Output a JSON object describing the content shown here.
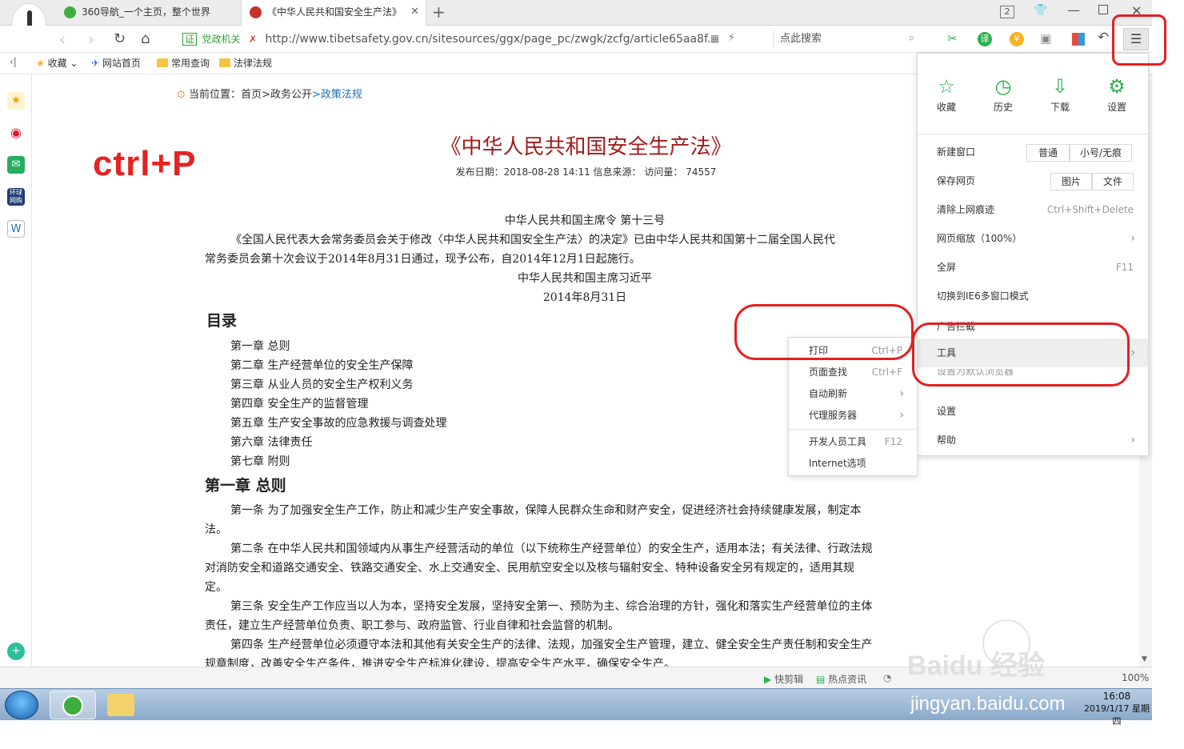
{
  "tabs": [
    {
      "title": "360导航_一个主页，整个世界"
    },
    {
      "title": "《中华人民共和国安全生产法》"
    }
  ],
  "tabbar": {
    "tab_count": "2"
  },
  "address": {
    "badge": "证",
    "site_label": "党政机关",
    "url": "http://www.tibetsafety.gov.cn/sitesources/ggx/page_pc/zwgk/zcfg/article65aa8f.",
    "search_placeholder": "点此搜索"
  },
  "favorites": [
    {
      "label": "收藏"
    },
    {
      "label": "网站首页"
    },
    {
      "label": "常用查询"
    },
    {
      "label": "法律法规"
    }
  ],
  "breadcrumb": {
    "prefix": "当前位置：",
    "home": "首页",
    "sep1": ">",
    "section": "政务公开",
    "sep2": ">",
    "current": "政策法规"
  },
  "article": {
    "title": "《中华人民共和国安全生产法》",
    "meta": "发布日期：2018-08-28 14:11    信息来源：    访问量：  74557",
    "order": "中华人民共和国主席令  第十三号",
    "intro1": "《全国人民代表大会常务委员会关于修改〈中华人民共和国安全生产法〉的决定》已由中华人民共和国第十二届全国人民代",
    "intro2": "常务委员会第十次会议于2014年8月31日通过，现予公布，自2014年12月1日起施行。",
    "signer": "中华人民共和国主席习近平",
    "date": "2014年8月31日",
    "toc_heading": "目录",
    "toc": [
      "第一章 总则",
      "第二章 生产经营单位的安全生产保障",
      "第三章 从业人员的安全生产权利义务",
      "第四章 安全生产的监督管理",
      "第五章 生产安全事故的应急救援与调查处理",
      "第六章 法律责任",
      "第七章 附则"
    ],
    "chapter1": "第一章   总则",
    "p1a": "第一条 为了加强安全生产工作，防止和减少生产安全事故，保障人民群众生命和财产安全，促进经济社会持续健康发展，制定本",
    "p1b": "法。",
    "p2a": "第二条 在中华人民共和国领域内从事生产经营活动的单位（以下统称生产经营单位）的安全生产，适用本法；有关法律、行政法规",
    "p2b": "对消防安全和道路交通安全、铁路交通安全、水上交通安全、民用航空安全以及核与辐射安全、特种设备安全另有规定的，适用其规",
    "p2c": "定。",
    "p3a": "第三条 安全生产工作应当以人为本，坚持安全发展，坚持安全第一、预防为主、综合治理的方针，强化和落实生产经营单位的主体",
    "p3b": "责任，建立生产经营单位负责、职工参与、政府监管、行业自律和社会监督的机制。",
    "p4a": "第四条 生产经营单位必须遵守本法和其他有关安全生产的法律、法规，加强安全生产管理，建立、健全安全生产责任制和安全生产",
    "p4b": "规章制度，改善安全生产条件，推进安全生产标准化建设，提高安全生产水平，确保安全生产。"
  },
  "annotation": {
    "ctrl_p": "ctrl+P"
  },
  "main_menu": {
    "top": [
      {
        "label": "收藏",
        "icon": "star-icon"
      },
      {
        "label": "历史",
        "icon": "clock-icon"
      },
      {
        "label": "下载",
        "icon": "download-icon"
      },
      {
        "label": "设置",
        "icon": "gear-icon"
      }
    ],
    "new_window": "新建窗口",
    "new_window_normal": "普通",
    "new_window_small": "小号/无痕",
    "save_page": "保存网页",
    "save_image": "图片",
    "save_file": "文件",
    "clear_traces": "清除上网痕迹",
    "clear_traces_shortcut": "Ctrl+Shift+Delete",
    "zoom": "网页缩放（100%）",
    "fullscreen": "全屏",
    "fullscreen_shortcut": "F11",
    "ie6_mode": "切换到IE6多窗口模式",
    "adblock": "广告拦截",
    "tools": "工具",
    "set_default": "设置为默认浏览器",
    "settings": "设置",
    "help": "帮助"
  },
  "tools_submenu": [
    {
      "label": "打印",
      "shortcut": "Ctrl+P"
    },
    {
      "label": "页面查找",
      "shortcut": "Ctrl+F"
    },
    {
      "label": "自动刷新",
      "shortcut": ""
    },
    {
      "label": "代理服务器",
      "shortcut": ""
    },
    {
      "label": "开发人员工具",
      "shortcut": "F12"
    },
    {
      "label": "Internet选项",
      "shortcut": ""
    }
  ],
  "statusbar": {
    "quick_clip": "快剪辑",
    "hot_news": "热点资讯",
    "zoom": "100%"
  },
  "taskbar": {
    "time": "16:08",
    "date": "2019/1/17 星期四"
  },
  "watermark": {
    "brand": "Baidu 经验",
    "url": "jingyan.baidu.com"
  },
  "colors": {
    "accent_red": "#e32020",
    "title_red": "#a21c1c",
    "link_blue": "#1c6fb5",
    "menu_green": "#2bb24c"
  }
}
